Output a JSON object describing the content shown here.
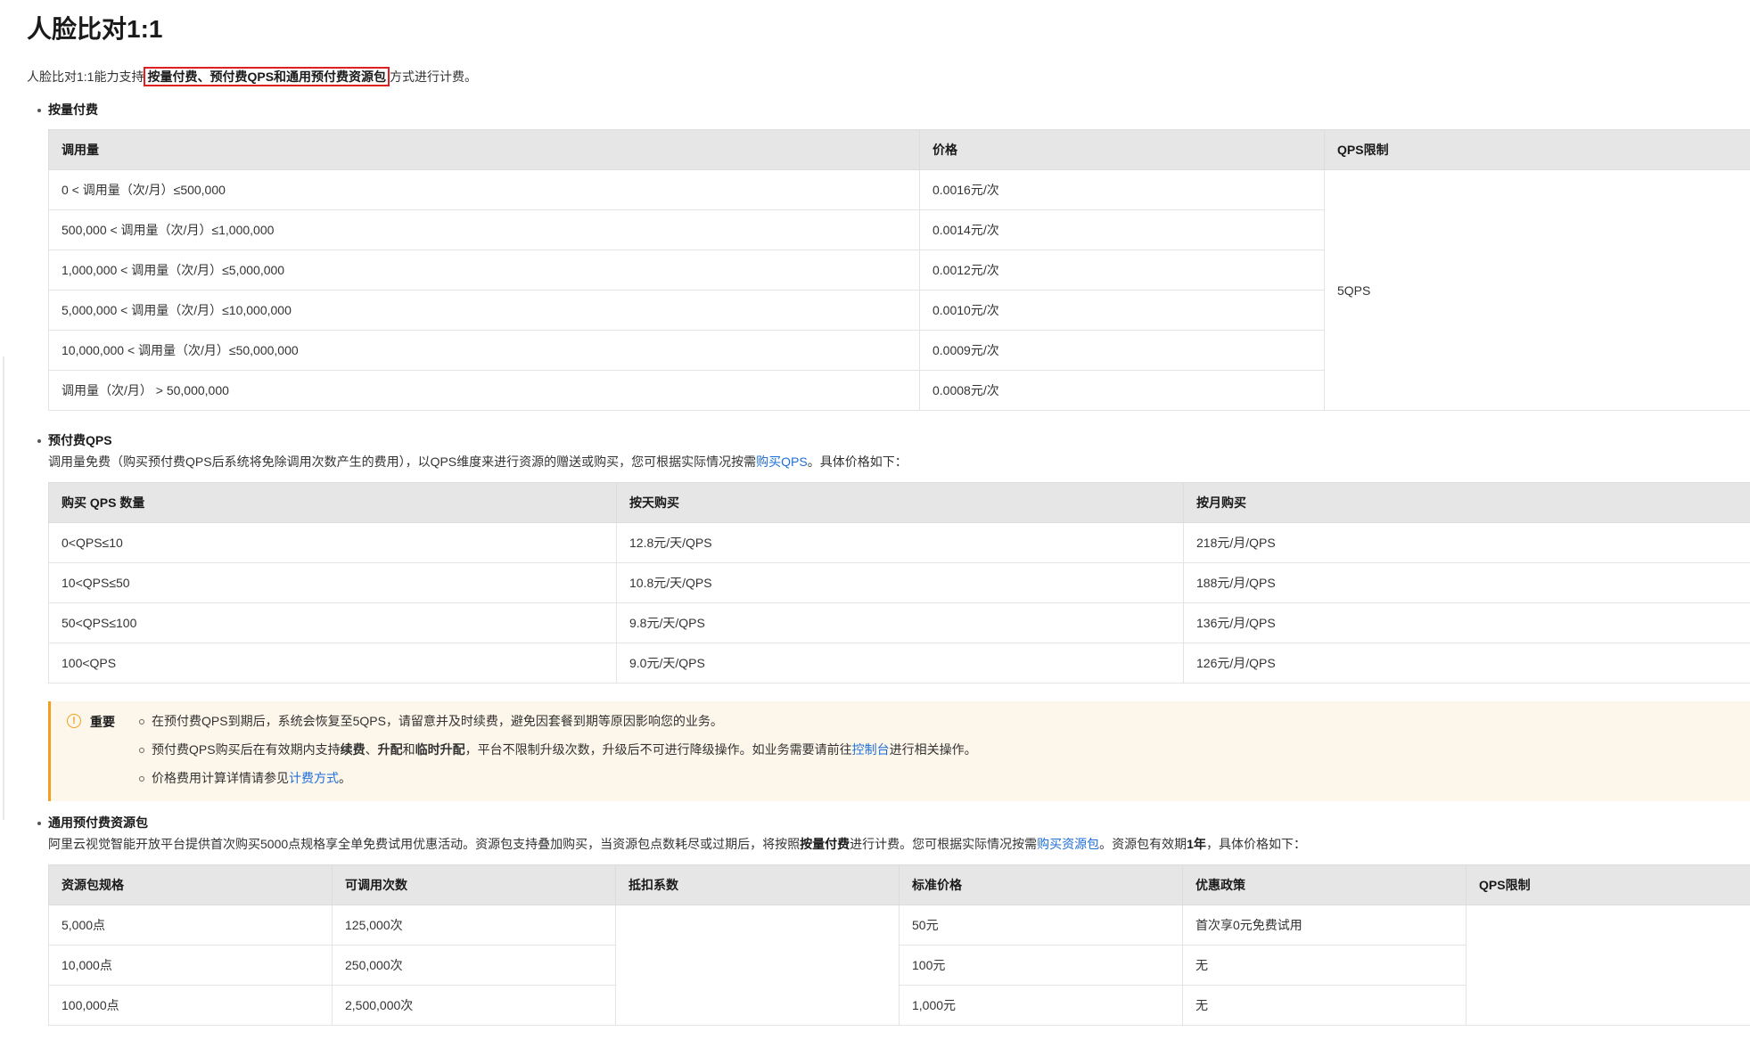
{
  "title": "人脸比对1:1",
  "intro": {
    "before": "人脸比对1:1能力支持",
    "highlight": "按量付费、预付费QPS和通用预付费资源包",
    "after": "方式进行计费。"
  },
  "section1": {
    "title": "按量付费",
    "headers": [
      "调用量",
      "价格",
      "QPS限制"
    ],
    "rows": [
      [
        "0 < 调用量（次/月）≤500,000",
        "0.0016元/次"
      ],
      [
        "500,000 < 调用量（次/月）≤1,000,000",
        "0.0014元/次"
      ],
      [
        "1,000,000 < 调用量（次/月）≤5,000,000",
        "0.0012元/次"
      ],
      [
        "5,000,000 < 调用量（次/月）≤10,000,000",
        "0.0010元/次"
      ],
      [
        "10,000,000 < 调用量（次/月）≤50,000,000",
        "0.0009元/次"
      ],
      [
        "调用量（次/月） > 50,000,000",
        "0.0008元/次"
      ]
    ],
    "qps": "5QPS"
  },
  "section2": {
    "title": "预付费QPS",
    "desc_before": "调用量免费（购买预付费QPS后系统将免除调用次数产生的费用），以QPS维度来进行资源的赠送或购买，您可根据实际情况按需",
    "desc_link": "购买QPS",
    "desc_after": "。具体价格如下：",
    "headers": [
      "购买 QPS 数量",
      "按天购买",
      "按月购买"
    ],
    "rows": [
      [
        "0<QPS≤10",
        "12.8元/天/QPS",
        "218元/月/QPS"
      ],
      [
        "10<QPS≤50",
        "10.8元/天/QPS",
        "188元/月/QPS"
      ],
      [
        "50<QPS≤100",
        "9.8元/天/QPS",
        "136元/月/QPS"
      ],
      [
        "100<QPS",
        "9.0元/天/QPS",
        "126元/月/QPS"
      ]
    ]
  },
  "note": {
    "icon": "info-icon",
    "label": "重要",
    "items": {
      "i1": "在预付费QPS到期后，系统会恢复至5QPS，请留意并及时续费，避免因套餐到期等原因影响您的业务。",
      "i2a": "预付费QPS购买后在有效期内支持",
      "i2b": "续费",
      "i2c": "、",
      "i2d": "升配",
      "i2e": "和",
      "i2f": "临时升配",
      "i2g": "，平台不限制升级次数，升级后不可进行降级操作。如业务需要请前往",
      "i2link": "控制台",
      "i2h": "进行相关操作。",
      "i3a": "价格费用计算详情请参见",
      "i3link": "计费方式",
      "i3b": "。"
    }
  },
  "section3": {
    "title": "通用预付费资源包",
    "d1": "阿里云视觉智能开放平台提供首次购买5000点规格享全单免费试用优惠活动。资源包支持叠加购买，当资源包点数耗尽或过期后，将按照",
    "d2": "按量付费",
    "d3": "进行计费。您可根据实际情况按需",
    "dlink": "购买资源包",
    "d4": "。资源包有效期",
    "d5": "1年",
    "d6": "，具体价格如下：",
    "headers": [
      "资源包规格",
      "可调用次数",
      "抵扣系数",
      "标准价格",
      "优惠政策",
      "QPS限制"
    ],
    "rows": [
      [
        "5,000点",
        "125,000次",
        "50元",
        "首次享0元免费试用"
      ],
      [
        "10,000点",
        "250,000次",
        "100元",
        "无"
      ],
      [
        "100,000点",
        "2,500,000次",
        "1,000元",
        "无"
      ]
    ]
  }
}
